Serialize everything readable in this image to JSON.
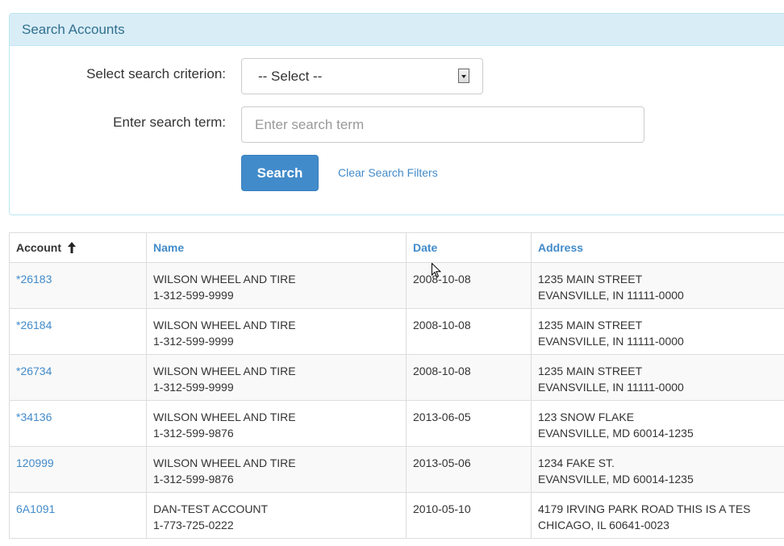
{
  "panel": {
    "title": "Search Accounts",
    "criterion_label": "Select search criterion:",
    "criterion_value": "-- Select --",
    "term_label": "Enter search term:",
    "term_placeholder": "Enter search term",
    "term_value": "",
    "search_button": "Search",
    "clear_link": "Clear Search Filters"
  },
  "table": {
    "headers": {
      "account": "Account",
      "name": "Name",
      "date": "Date",
      "address": "Address"
    },
    "sort": {
      "column": "account",
      "direction": "ascending",
      "icon": "arrow-up-icon"
    },
    "rows": [
      {
        "account": "*26183",
        "name": "WILSON WHEEL AND TIRE",
        "phone": "1-312-599-9999",
        "date": "2008-10-08",
        "address1": "1235 MAIN STREET",
        "address2": "EVANSVILLE, IN 11111-0000"
      },
      {
        "account": "*26184",
        "name": "WILSON WHEEL AND TIRE",
        "phone": "1-312-599-9999",
        "date": "2008-10-08",
        "address1": "1235 MAIN STREET",
        "address2": "EVANSVILLE, IN 11111-0000"
      },
      {
        "account": "*26734",
        "name": "WILSON WHEEL AND TIRE",
        "phone": "1-312-599-9999",
        "date": "2008-10-08",
        "address1": "1235 MAIN STREET",
        "address2": "EVANSVILLE, IN 11111-0000"
      },
      {
        "account": "*34136",
        "name": "WILSON WHEEL AND TIRE",
        "phone": "1-312-599-9876",
        "date": "2013-06-05",
        "address1": "123 SNOW FLAKE",
        "address2": "EVANSVILLE, MD 60014-1235"
      },
      {
        "account": "120999",
        "name": "WILSON WHEEL AND TIRE",
        "phone": "1-312-599-9876",
        "date": "2013-05-06",
        "address1": "1234 FAKE ST.",
        "address2": "EVANSVILLE, MD 60014-1235"
      },
      {
        "account": "6A1091",
        "name": "DAN-TEST ACCOUNT",
        "phone": "1-773-725-0222",
        "date": "2010-05-10",
        "address1": "4179 IRVING PARK ROAD THIS IS A TES",
        "address2": "CHICAGO, IL 60641-0023"
      }
    ]
  },
  "colors": {
    "accent": "#428bca",
    "panel_heading_bg": "#d9edf7",
    "panel_heading_text": "#31708f",
    "stripe": "#f9f9f9"
  }
}
